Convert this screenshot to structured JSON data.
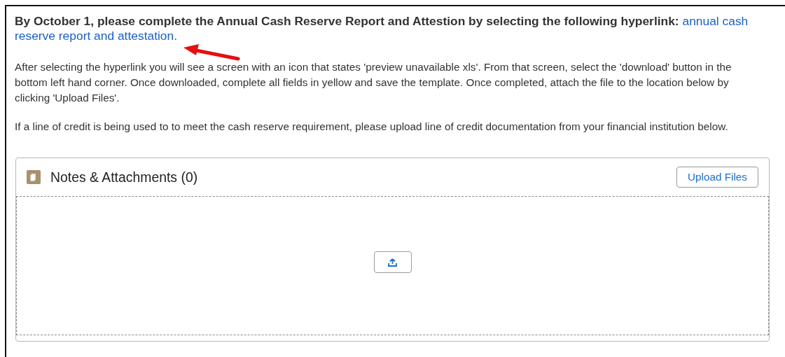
{
  "instructions": {
    "heading": "By October 1, please complete the Annual Cash Reserve Report and Attestion by selecting the following hyperlink:",
    "link_lines": [
      "annual cash",
      "reserve report and attestation."
    ],
    "paragraphs": [
      "After selecting the hyperlink you will see a screen with an icon that states 'preview unavailable xls'. From that screen, select the 'download' button in the bottom left hand corner. Once downloaded, complete all fields in yellow and save the template. Once completed, attach the file to the location below by clicking 'Upload Files'.",
      "If a line of credit is being used to to meet the cash reserve requirement, please upload line of credit documentation from your financial institution below."
    ]
  },
  "attachments": {
    "title": "Notes & Attachments (0)",
    "upload_button": "Upload Files"
  }
}
